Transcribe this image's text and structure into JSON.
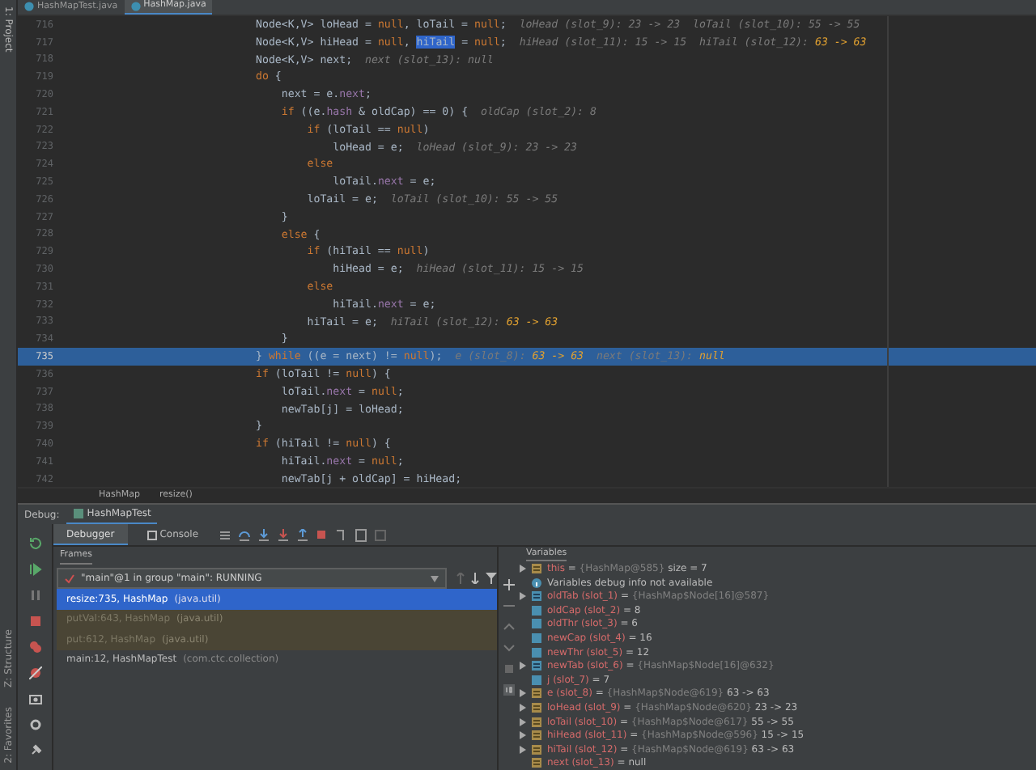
{
  "left_strip": {
    "top_label": "1: Project",
    "bottom_labels": [
      "Z: Structure",
      "2: Favorites"
    ]
  },
  "editor_tabs": [
    {
      "label": "HashMapTest.java",
      "selected": false
    },
    {
      "label": "HashMap.java",
      "selected": true
    }
  ],
  "code_lines": [
    {
      "number": "716",
      "current": false,
      "segments": [
        {
          "kind": "plain",
          "text": "Node<K,V> loHead = "
        },
        {
          "kind": "keyword",
          "text": "null"
        },
        {
          "kind": "plain",
          "text": ", loTail = "
        },
        {
          "kind": "keyword",
          "text": "null"
        },
        {
          "kind": "plain",
          "text": ";"
        },
        {
          "kind": "hint",
          "text": "  loHead (slot_9): 23 -> 23  loTail (slot_10): 55 -> 55"
        }
      ]
    },
    {
      "number": "717",
      "current": false,
      "segments": [
        {
          "kind": "plain",
          "text": "Node<K,V> hiHead = "
        },
        {
          "kind": "keyword",
          "text": "null"
        },
        {
          "kind": "plain",
          "text": ", "
        },
        {
          "kind": "selection",
          "text": "hiTail"
        },
        {
          "kind": "plain",
          "text": " = "
        },
        {
          "kind": "keyword",
          "text": "null"
        },
        {
          "kind": "plain",
          "text": ";"
        },
        {
          "kind": "hint",
          "text": "  hiHead (slot_11): 15 -> 15  hiTail (slot_12): "
        },
        {
          "kind": "changed",
          "text": "63 -> 63"
        }
      ]
    },
    {
      "number": "718",
      "current": false,
      "segments": [
        {
          "kind": "plain",
          "text": "Node<K,V> next;"
        },
        {
          "kind": "hint",
          "text": "  next (slot_13): null"
        }
      ]
    },
    {
      "number": "719",
      "current": false,
      "segments": [
        {
          "kind": "keyword",
          "text": "do"
        },
        {
          "kind": "plain",
          "text": " {"
        }
      ]
    },
    {
      "number": "720",
      "current": false,
      "segments": [
        {
          "kind": "plain",
          "text": "    next = e."
        },
        {
          "kind": "field",
          "text": "next"
        },
        {
          "kind": "plain",
          "text": ";"
        }
      ]
    },
    {
      "number": "721",
      "current": false,
      "segments": [
        {
          "kind": "keyword",
          "text": "    if"
        },
        {
          "kind": "plain",
          "text": " ((e."
        },
        {
          "kind": "field",
          "text": "hash"
        },
        {
          "kind": "plain",
          "text": " & oldCap) == 0) {"
        },
        {
          "kind": "hint",
          "text": "  oldCap (slot_2): 8"
        }
      ]
    },
    {
      "number": "722",
      "current": false,
      "segments": [
        {
          "kind": "keyword",
          "text": "        if"
        },
        {
          "kind": "plain",
          "text": " (loTail == "
        },
        {
          "kind": "keyword",
          "text": "null"
        },
        {
          "kind": "plain",
          "text": ")"
        }
      ]
    },
    {
      "number": "723",
      "current": false,
      "segments": [
        {
          "kind": "plain",
          "text": "            loHead = e;"
        },
        {
          "kind": "hint",
          "text": "  loHead (slot_9): 23 -> 23"
        }
      ]
    },
    {
      "number": "724",
      "current": false,
      "segments": [
        {
          "kind": "keyword",
          "text": "        else"
        }
      ]
    },
    {
      "number": "725",
      "current": false,
      "segments": [
        {
          "kind": "plain",
          "text": "            loTail."
        },
        {
          "kind": "field",
          "text": "next"
        },
        {
          "kind": "plain",
          "text": " = e;"
        }
      ]
    },
    {
      "number": "726",
      "current": false,
      "segments": [
        {
          "kind": "plain",
          "text": "        loTail = e;"
        },
        {
          "kind": "hint",
          "text": "  loTail (slot_10): 55 -> 55"
        }
      ]
    },
    {
      "number": "727",
      "current": false,
      "segments": [
        {
          "kind": "plain",
          "text": "    }"
        }
      ]
    },
    {
      "number": "728",
      "current": false,
      "segments": [
        {
          "kind": "keyword",
          "text": "    else"
        },
        {
          "kind": "plain",
          "text": " {"
        }
      ]
    },
    {
      "number": "729",
      "current": false,
      "segments": [
        {
          "kind": "keyword",
          "text": "        if"
        },
        {
          "kind": "plain",
          "text": " (hiTail == "
        },
        {
          "kind": "keyword",
          "text": "null"
        },
        {
          "kind": "plain",
          "text": ")"
        }
      ]
    },
    {
      "number": "730",
      "current": false,
      "segments": [
        {
          "kind": "plain",
          "text": "            hiHead = e;"
        },
        {
          "kind": "hint",
          "text": "  hiHead (slot_11): 15 -> 15"
        }
      ]
    },
    {
      "number": "731",
      "current": false,
      "segments": [
        {
          "kind": "keyword",
          "text": "        else"
        }
      ]
    },
    {
      "number": "732",
      "current": false,
      "segments": [
        {
          "kind": "plain",
          "text": "            hiTail."
        },
        {
          "kind": "field",
          "text": "next"
        },
        {
          "kind": "plain",
          "text": " = e;"
        }
      ]
    },
    {
      "number": "733",
      "current": false,
      "segments": [
        {
          "kind": "plain",
          "text": "        hiTail = e;"
        },
        {
          "kind": "hint",
          "text": "  hiTail (slot_12): "
        },
        {
          "kind": "changed",
          "text": "63 -> 63"
        }
      ]
    },
    {
      "number": "734",
      "current": false,
      "segments": [
        {
          "kind": "plain",
          "text": "    }"
        }
      ]
    },
    {
      "number": "735",
      "current": true,
      "segments": [
        {
          "kind": "plain",
          "text": "} "
        },
        {
          "kind": "keyword",
          "text": "while"
        },
        {
          "kind": "plain",
          "text": " ((e = next) != "
        },
        {
          "kind": "keyword",
          "text": "null"
        },
        {
          "kind": "plain",
          "text": ");"
        },
        {
          "kind": "hint",
          "text": "  e (slot_8): "
        },
        {
          "kind": "changed",
          "text": "63 -> 63"
        },
        {
          "kind": "hint",
          "text": "  next (slot_13): "
        },
        {
          "kind": "changed",
          "text": "null"
        }
      ]
    },
    {
      "number": "736",
      "current": false,
      "segments": [
        {
          "kind": "keyword",
          "text": "if"
        },
        {
          "kind": "plain",
          "text": " (loTail != "
        },
        {
          "kind": "keyword",
          "text": "null"
        },
        {
          "kind": "plain",
          "text": ") {"
        }
      ]
    },
    {
      "number": "737",
      "current": false,
      "segments": [
        {
          "kind": "plain",
          "text": "    loTail."
        },
        {
          "kind": "field",
          "text": "next"
        },
        {
          "kind": "plain",
          "text": " = "
        },
        {
          "kind": "keyword",
          "text": "null"
        },
        {
          "kind": "plain",
          "text": ";"
        }
      ]
    },
    {
      "number": "738",
      "current": false,
      "segments": [
        {
          "kind": "plain",
          "text": "    newTab[j] = loHead;"
        }
      ]
    },
    {
      "number": "739",
      "current": false,
      "segments": [
        {
          "kind": "plain",
          "text": "}"
        }
      ]
    },
    {
      "number": "740",
      "current": false,
      "segments": [
        {
          "kind": "keyword",
          "text": "if"
        },
        {
          "kind": "plain",
          "text": " (hiTail != "
        },
        {
          "kind": "keyword",
          "text": "null"
        },
        {
          "kind": "plain",
          "text": ") {"
        }
      ]
    },
    {
      "number": "741",
      "current": false,
      "segments": [
        {
          "kind": "plain",
          "text": "    hiTail."
        },
        {
          "kind": "field",
          "text": "next"
        },
        {
          "kind": "plain",
          "text": " = "
        },
        {
          "kind": "keyword",
          "text": "null"
        },
        {
          "kind": "plain",
          "text": ";"
        }
      ]
    },
    {
      "number": "742",
      "current": false,
      "segments": [
        {
          "kind": "plain",
          "text": "    newTab[j + oldCap] = hiHead;"
        }
      ]
    }
  ],
  "breadcrumbs": [
    "HashMap",
    "resize()"
  ],
  "debug_bar": {
    "label": "Debug:",
    "session": "HashMapTest"
  },
  "debug_tabs": [
    {
      "label": "Debugger",
      "selected": true
    },
    {
      "label": "Console",
      "selected": false
    }
  ],
  "frames": {
    "title": "Frames",
    "thread": "\"main\"@1 in group \"main\": RUNNING",
    "items": [
      {
        "method": "resize:735, HashMap",
        "location": "(java.util)",
        "selected": true,
        "library": false
      },
      {
        "method": "putVal:643, HashMap",
        "location": "(java.util)",
        "selected": false,
        "library": true
      },
      {
        "method": "put:612, HashMap",
        "location": "(java.util)",
        "selected": false,
        "library": true
      },
      {
        "method": "main:12, HashMapTest",
        "location": "(com.ctc.collection)",
        "selected": false,
        "library": false
      }
    ]
  },
  "variables": {
    "title": "Variables",
    "items": [
      {
        "kind": "object",
        "expandable": true,
        "name": "this",
        "assign": "=",
        "value": "{HashMap@585}",
        "extra": "size = 7"
      },
      {
        "kind": "info",
        "expandable": false,
        "name": "Variables debug info not available"
      },
      {
        "kind": "array",
        "expandable": true,
        "name": "oldTab (slot_1)",
        "assign": "=",
        "value": "{HashMap$Node[16]@587}"
      },
      {
        "kind": "primitive",
        "expandable": false,
        "name": "oldCap (slot_2)",
        "assign": "=",
        "extra": "8"
      },
      {
        "kind": "primitive",
        "expandable": false,
        "name": "oldThr (slot_3)",
        "assign": "=",
        "extra": "6"
      },
      {
        "kind": "primitive",
        "expandable": false,
        "name": "newCap (slot_4)",
        "assign": "=",
        "extra": "16"
      },
      {
        "kind": "primitive",
        "expandable": false,
        "name": "newThr (slot_5)",
        "assign": "=",
        "extra": "12"
      },
      {
        "kind": "array",
        "expandable": true,
        "name": "newTab (slot_6)",
        "assign": "=",
        "value": "{HashMap$Node[16]@632}"
      },
      {
        "kind": "primitive",
        "expandable": false,
        "name": "j (slot_7)",
        "assign": "=",
        "extra": "7"
      },
      {
        "kind": "object",
        "expandable": true,
        "name": "e (slot_8)",
        "assign": "=",
        "value": "{HashMap$Node@619}",
        "extra": "63 -> 63"
      },
      {
        "kind": "object",
        "expandable": true,
        "name": "loHead (slot_9)",
        "assign": "=",
        "value": "{HashMap$Node@620}",
        "extra": "23 -> 23"
      },
      {
        "kind": "object",
        "expandable": true,
        "name": "loTail (slot_10)",
        "assign": "=",
        "value": "{HashMap$Node@617}",
        "extra": "55 -> 55"
      },
      {
        "kind": "object",
        "expandable": true,
        "name": "hiHead (slot_11)",
        "assign": "=",
        "value": "{HashMap$Node@596}",
        "extra": "15 -> 15"
      },
      {
        "kind": "object",
        "expandable": true,
        "name": "hiTail (slot_12)",
        "assign": "=",
        "value": "{HashMap$Node@619}",
        "extra": "63 -> 63"
      },
      {
        "kind": "object",
        "expandable": false,
        "name": "next (slot_13)",
        "assign": "=",
        "extra": "null"
      }
    ]
  }
}
